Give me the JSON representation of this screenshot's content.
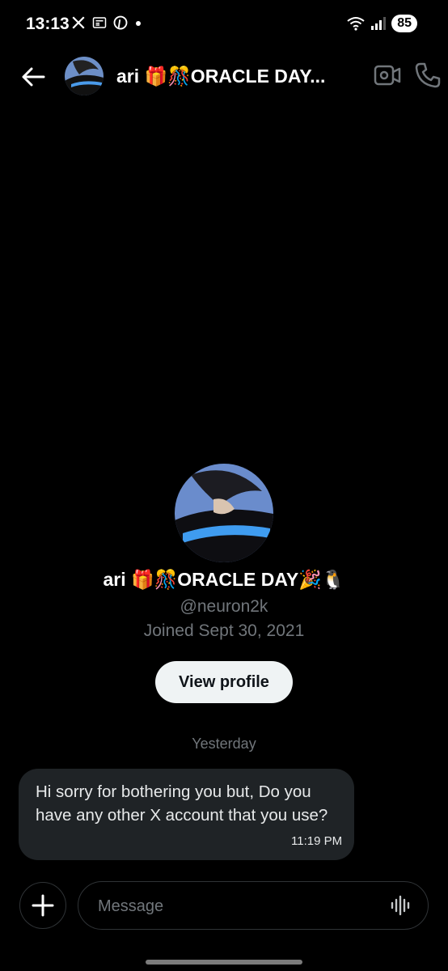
{
  "status_bar": {
    "time": "13:13",
    "battery": "85",
    "icons": [
      "x-logo-icon",
      "news-icon",
      "pinterest-icon",
      "dot-icon",
      "wifi-icon",
      "signal-icon",
      "battery-icon"
    ]
  },
  "header": {
    "back_icon": "back-arrow-icon",
    "title": "ari 🎁🎊ORACLE DAY...",
    "video_icon": "video-call-icon",
    "call_icon": "phone-icon"
  },
  "profile": {
    "name": "ari 🎁🎊ORACLE DAY🎉🐧",
    "handle": "@neuron2k",
    "joined": "Joined Sept 30, 2021",
    "view_profile_label": "View profile"
  },
  "conversation": {
    "date_separator": "Yesterday",
    "messages": [
      {
        "text": "Hi sorry for bothering you but, Do you have any other X account that you use?",
        "time": "11:19 PM"
      }
    ]
  },
  "composer": {
    "placeholder": "Message",
    "plus_icon": "plus-icon",
    "voice_icon": "voice-wave-icon"
  },
  "colors": {
    "background": "#000000",
    "bubble": "#1f2326",
    "muted_text": "#71767b",
    "button_bg": "#eff3f4"
  }
}
